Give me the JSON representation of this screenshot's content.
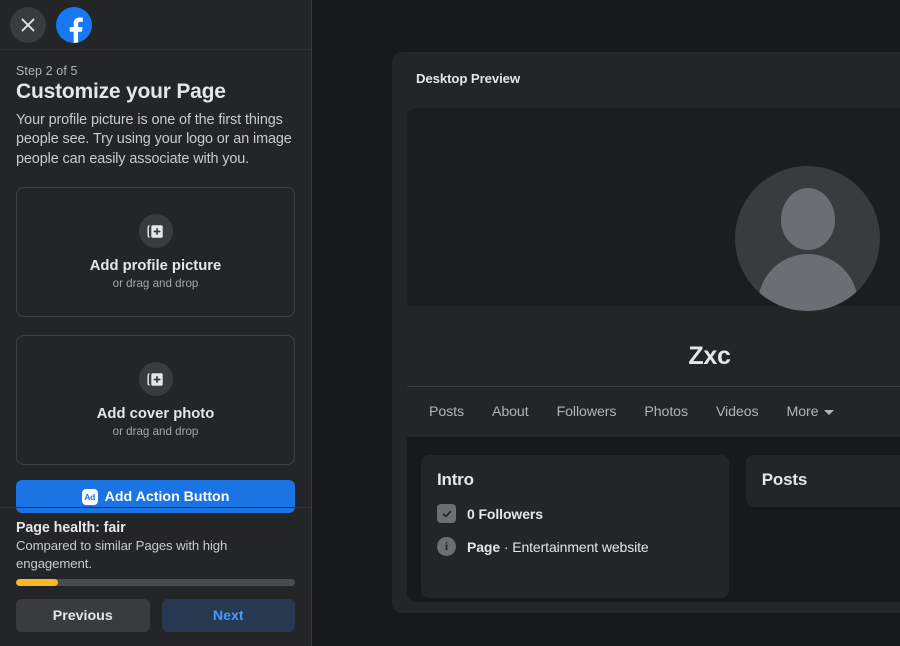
{
  "sidebar": {
    "close_icon": "close-icon",
    "brand_icon": "facebook-logo",
    "step_label": "Step 2 of 5",
    "title": "Customize your Page",
    "description": "Your profile picture is one of the first things people see. Try using your logo or an image people can easily associate with you.",
    "upload_cards": [
      {
        "icon": "add-photo-icon",
        "title": "Add profile picture",
        "subtitle": "or drag and drop"
      },
      {
        "icon": "add-photo-icon",
        "title": "Add cover photo",
        "subtitle": "or drag and drop"
      }
    ],
    "action_button": {
      "badge": "Ad",
      "label": "Add Action Button"
    },
    "health": {
      "title": "Page health: fair",
      "subtitle": "Compared to similar Pages with high engagement.",
      "progress_percent": 15,
      "progress_color": "#f7b928"
    },
    "nav": {
      "previous": "Previous",
      "next": "Next"
    }
  },
  "preview": {
    "header": "Desktop Preview",
    "page_name": "Zxc",
    "avatar_icon": "default-avatar-icon",
    "tabs": [
      {
        "label": "Posts"
      },
      {
        "label": "About"
      },
      {
        "label": "Followers"
      },
      {
        "label": "Photos"
      },
      {
        "label": "Videos"
      },
      {
        "label": "More"
      }
    ],
    "intro": {
      "title": "Intro",
      "rows": [
        {
          "icon": "followers-check-icon",
          "text": "0 Followers",
          "bold": true
        },
        {
          "icon": "info-icon",
          "text_bold": "Page",
          "text_rest": " · Entertainment website"
        }
      ]
    },
    "posts": {
      "title": "Posts"
    }
  },
  "colors": {
    "accent": "#1b74e4",
    "panel": "#242526",
    "background": "#18191a",
    "next_text": "#4599ff",
    "next_bg": "#263951"
  }
}
